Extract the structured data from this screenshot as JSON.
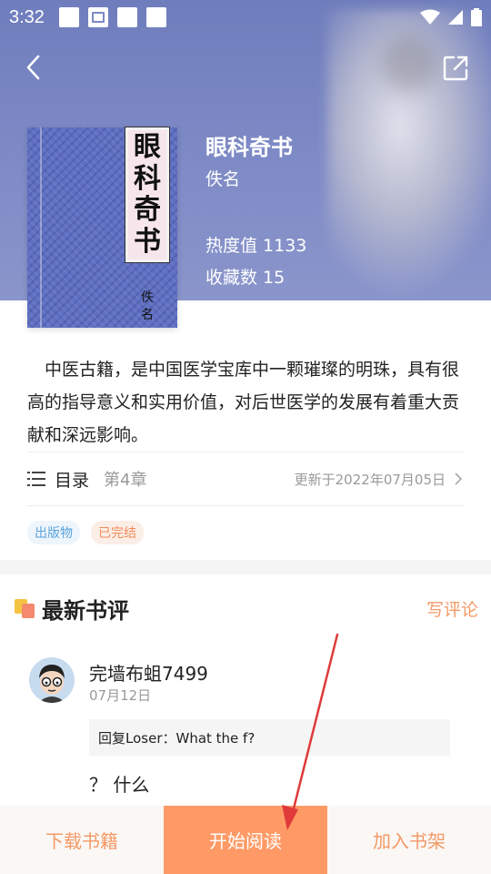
{
  "status_bar": {
    "time": "3:32"
  },
  "book": {
    "title": "眼科奇书",
    "author": "佚名",
    "heat": "热度值 1133",
    "favorites": "收藏数 15",
    "cover_title_chars": [
      "眼",
      "科",
      "奇",
      "书"
    ],
    "cover_author_chars": [
      "佚",
      "名"
    ],
    "summary": "中医古籍，是中国医学宝库中一颗璀璨的明珠，具有很高的指导意义和实用价值，对后世医学的发展有着重大贡献和深远影响。"
  },
  "toc": {
    "label": "目录",
    "chapter": "第4章",
    "updated": "更新于2022年07月05日"
  },
  "tags": [
    "出版物",
    "已完结"
  ],
  "reviews": {
    "title": "最新书评",
    "write_label": "写评论",
    "items": [
      {
        "name": "完墙布蛆7499",
        "date": "07月12日",
        "reply": "回复Loser：What the f?",
        "text": "？ 什么"
      }
    ]
  },
  "bottom_bar": {
    "download": "下载书籍",
    "read": "开始阅读",
    "shelf": "加入书架"
  },
  "colors": {
    "accent": "#ff9a66",
    "accent_text": "#f39a67",
    "header_bg": "#7f8bc6",
    "annotation": "#e03a3a"
  }
}
